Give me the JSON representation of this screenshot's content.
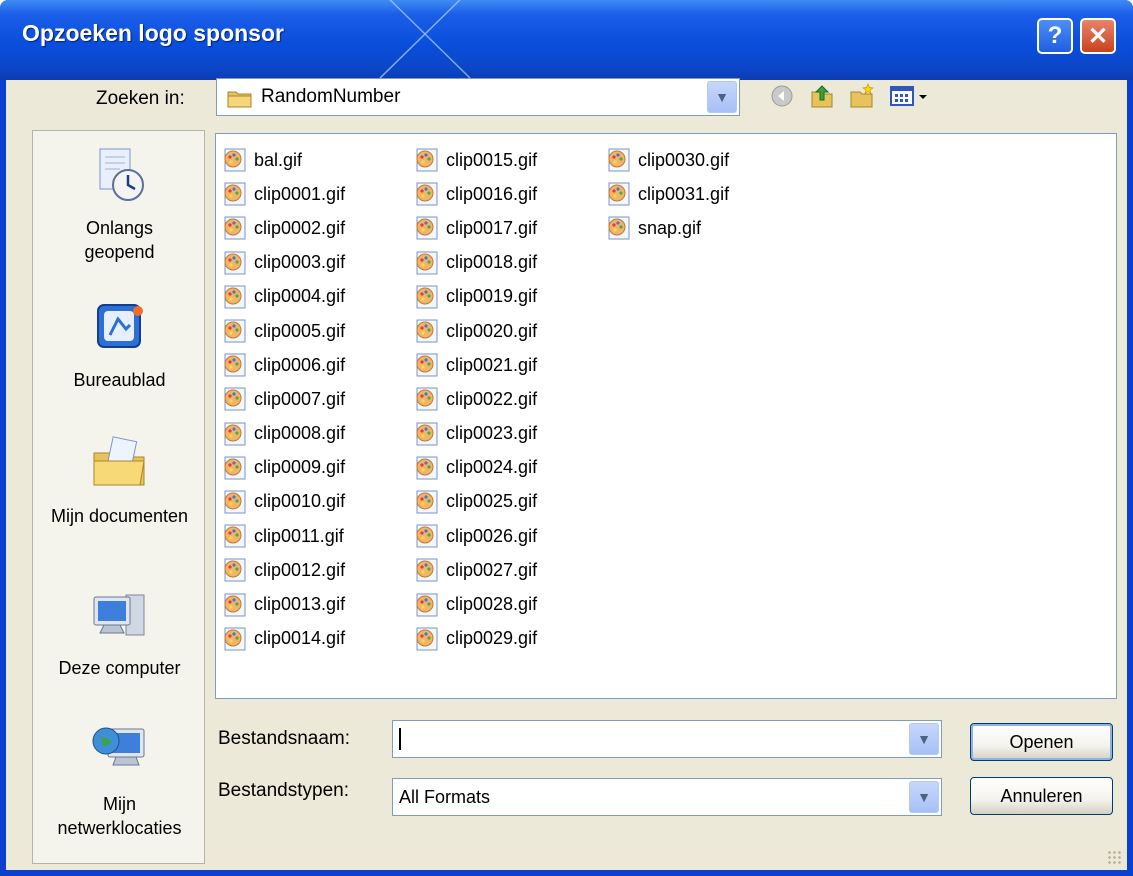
{
  "window": {
    "title": "Opzoeken logo sponsor"
  },
  "titlebar_buttons": {
    "help": "?",
    "close": "✕"
  },
  "look_in": {
    "label": "Zoeken in:",
    "value": "RandomNumber"
  },
  "toolbar": {
    "icons": [
      "back-icon",
      "up-folder-icon",
      "new-folder-icon",
      "view-menu-icon"
    ]
  },
  "places": [
    {
      "label": "Onlangs geopend",
      "icon": "recent-documents-icon"
    },
    {
      "label": "Bureaublad",
      "icon": "desktop-icon"
    },
    {
      "label": "Mijn documenten",
      "icon": "my-documents-icon"
    },
    {
      "label": "Deze computer",
      "icon": "my-computer-icon"
    },
    {
      "label": "Mijn netwerklocaties",
      "icon": "network-places-icon"
    }
  ],
  "files": {
    "column_1": [
      "bal.gif",
      "clip0001.gif",
      "clip0002.gif",
      "clip0003.gif",
      "clip0004.gif",
      "clip0005.gif",
      "clip0006.gif",
      "clip0007.gif",
      "clip0008.gif",
      "clip0009.gif",
      "clip0010.gif",
      "clip0011.gif",
      "clip0012.gif",
      "clip0013.gif",
      "clip0014.gif"
    ],
    "column_2": [
      "clip0015.gif",
      "clip0016.gif",
      "clip0017.gif",
      "clip0018.gif",
      "clip0019.gif",
      "clip0020.gif",
      "clip0021.gif",
      "clip0022.gif",
      "clip0023.gif",
      "clip0024.gif",
      "clip0025.gif",
      "clip0026.gif",
      "clip0027.gif",
      "clip0028.gif",
      "clip0029.gif"
    ],
    "column_3": [
      "clip0030.gif",
      "clip0031.gif",
      "snap.gif"
    ],
    "icon": "gif-image-icon"
  },
  "filename": {
    "label": "Bestandsnaam:",
    "value": ""
  },
  "filetype": {
    "label": "Bestandstypen:",
    "value": "All Formats"
  },
  "buttons": {
    "open": "Openen",
    "cancel": "Annuleren"
  },
  "colors": {
    "titlebar": "#0a4edc",
    "dialog_bg": "#ece9d8",
    "close_red": "#c9421d"
  }
}
